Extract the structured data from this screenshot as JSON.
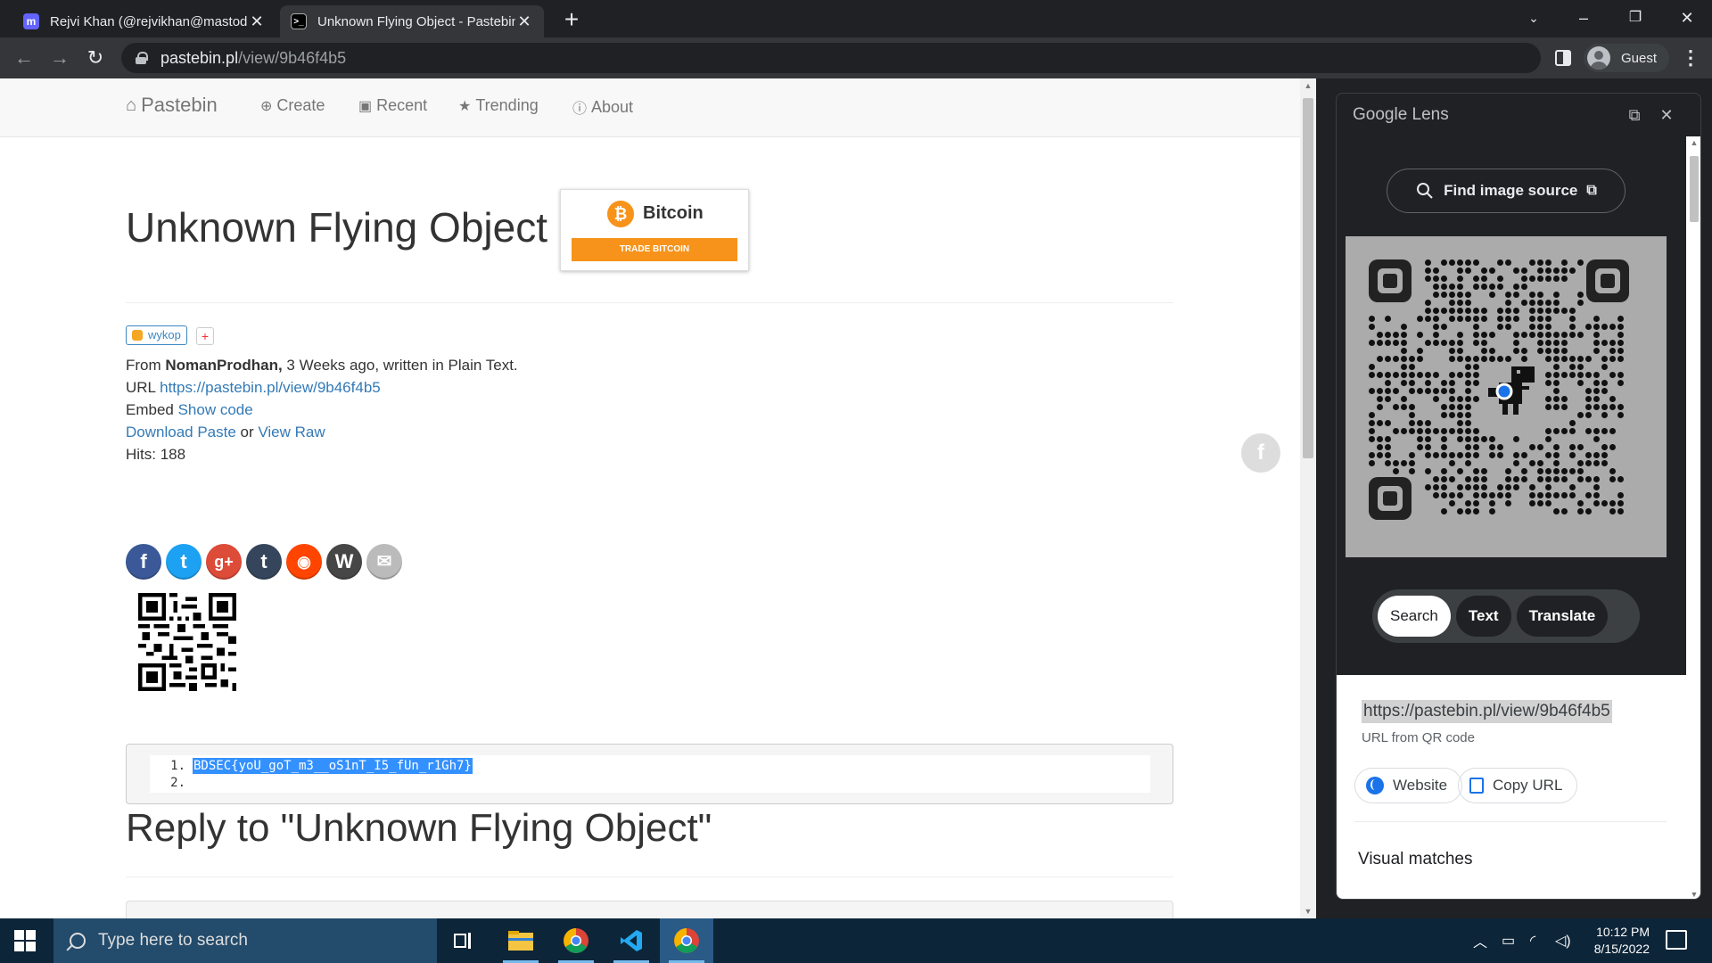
{
  "tabs": [
    {
      "title": "Rejvi Khan (@rejvikhan@mastod",
      "favicon": "mastodon-icon",
      "active": false
    },
    {
      "title": "Unknown Flying Object - Pastebin",
      "favicon": "pastebin-icon",
      "active": true
    }
  ],
  "omnibox": {
    "host": "pastebin.pl",
    "path": "/view/9b46f4b5"
  },
  "profile": {
    "label": "Guest"
  },
  "site_nav": {
    "brand": "Pastebin",
    "items": [
      "Create",
      "Recent",
      "Trending",
      "About"
    ]
  },
  "paste": {
    "title": "Unknown Flying Object",
    "ad": {
      "name": "Bitcoin",
      "cta": "TRADE BITCOIN"
    },
    "share_widget": "wykop",
    "share_plus": "+",
    "from_prefix": "From ",
    "author": "NomanProdhan,",
    "from_suffix": " 3 Weeks ago, written in Plain Text.",
    "url_label": "URL ",
    "url": "https://pastebin.pl/view/9b46f4b5",
    "embed_label": "Embed ",
    "embed_link": "Show code",
    "download_link": "Download Paste",
    "or_text": " or ",
    "raw_link": "View Raw",
    "hits": "Hits: 188",
    "code_lines": [
      {
        "num": "1.",
        "text": "BDSEC{yoU_goT_m3__oS1nT_I5_fUn_r1Gh7}"
      },
      {
        "num": "2.",
        "text": ""
      }
    ],
    "reply_title": "Reply to \"Unknown Flying Object\""
  },
  "social_icons": [
    "facebook-icon",
    "twitter-icon",
    "google-plus-icon",
    "tumblr-icon",
    "reddit-icon",
    "wordpress-icon",
    "email-icon"
  ],
  "lens": {
    "title": "Google Lens",
    "find_source": "Find image source",
    "chips": [
      "Search",
      "Text",
      "Translate"
    ],
    "qr_url": "https://pastebin.pl/view/9b46f4b5",
    "qr_sub": "URL from QR code",
    "website_btn": "Website",
    "copy_btn": "Copy URL",
    "visual_matches": "Visual matches"
  },
  "taskbar": {
    "search_placeholder": "Type here to search",
    "time": "10:12 PM",
    "date": "8/15/2022"
  },
  "colors": {
    "chrome_dark": "#202124",
    "chrome_toolbar": "#35363a",
    "link": "#337ab7",
    "selection": "#3390ff",
    "bitcoin": "#f7931a",
    "taskbar": "#0d2538"
  }
}
